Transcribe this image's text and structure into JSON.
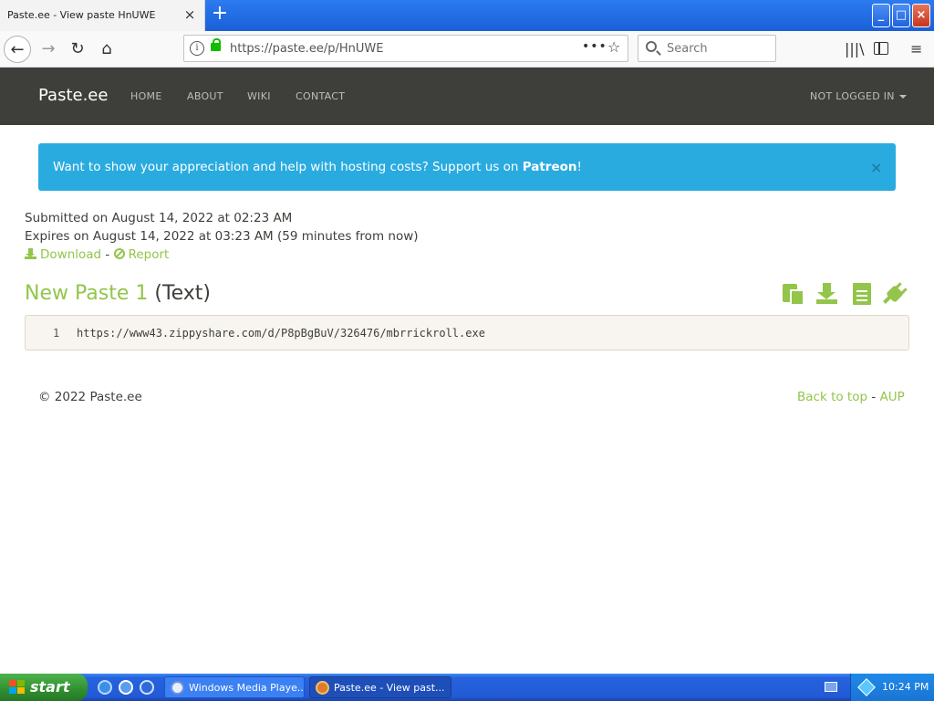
{
  "browser": {
    "tab_title": "Paste.ee - View paste HnUWE",
    "tab_close": "×",
    "new_tab": "+",
    "window_minimize": "_",
    "window_maximize": "□",
    "window_close": "×",
    "back": "←",
    "forward": "→",
    "reload": "↻",
    "home": "⌂",
    "url_info": "i",
    "url": "https://paste.ee/p/HnUWE",
    "url_more": "•••",
    "bookmark": "☆",
    "search_placeholder": "Search",
    "library": "|||\\",
    "menu": "≡"
  },
  "site_nav": {
    "brand": "Paste.ee",
    "links": [
      "HOME",
      "ABOUT",
      "WIKI",
      "CONTACT"
    ],
    "login": "NOT LOGGED IN"
  },
  "alert": {
    "text": "Want to show your appreciation and help with hosting costs? Support us on ",
    "link": "Patreon",
    "suffix": "!",
    "close": "×"
  },
  "paste": {
    "submitted": "Submitted on August 14, 2022 at 02:23 AM",
    "expires": "Expires on August 14, 2022 at 03:23 AM (59 minutes from now)",
    "download_label": "Download",
    "separator": " - ",
    "report_label": "Report",
    "title": "New Paste 1",
    "language": "(Text)",
    "lines": [
      {
        "number": "1",
        "content": "https://www43.zippyshare.com/d/P8pBgBuV/326476/mbrrickroll.exe"
      }
    ]
  },
  "footer": {
    "copyright": "© 2022 Paste.ee",
    "back_to_top": "Back to top",
    "separator": " - ",
    "aup": "AUP"
  },
  "taskbar": {
    "start": "start",
    "tasks": [
      "Windows Media Playe...",
      "Paste.ee - View past..."
    ],
    "clock": "10:24 PM"
  },
  "colors": {
    "accent_green": "#93c54b",
    "navbar_bg": "#3e3f3a",
    "alert_bg": "#29abe0"
  }
}
